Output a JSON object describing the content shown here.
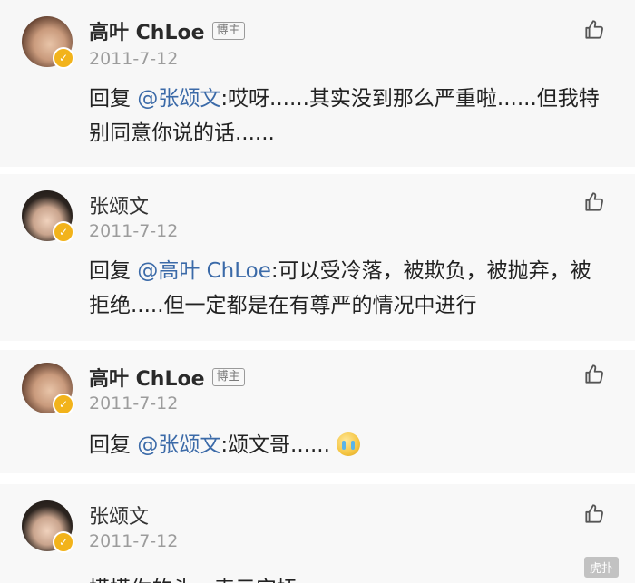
{
  "comments": [
    {
      "author": "高叶 ChLoe",
      "tag": "博主",
      "date": "2011-7-12",
      "reply_prefix": "回复 ",
      "mention": "@张颂文",
      "body": ":哎呀......其实没到那么严重啦......但我特别同意你说的话......"
    },
    {
      "author": "张颂文",
      "tag": "",
      "date": "2011-7-12",
      "reply_prefix": "回复 ",
      "mention": "@高叶 ChLoe",
      "body": ":可以受冷落，被欺负，被抛弃，被拒绝.....但一定都是在有尊严的情况中进行"
    },
    {
      "author": "高叶 ChLoe",
      "tag": "博主",
      "date": "2011-7-12",
      "reply_prefix": "回复 ",
      "mention": "@张颂文",
      "body": ":颂文哥......",
      "emoji": "crying-emoji"
    },
    {
      "author": "张颂文",
      "tag": "",
      "date": "2011-7-12",
      "body": "摸摸你的头，表示安抚"
    }
  ],
  "icons": {
    "like": "thumbs-up-icon",
    "verified": "verified-badge-icon"
  },
  "colors": {
    "mention": "#3b6aa8",
    "verified_badge": "#f2b31b",
    "date": "#9c9c9c"
  },
  "watermark": "虎扑"
}
